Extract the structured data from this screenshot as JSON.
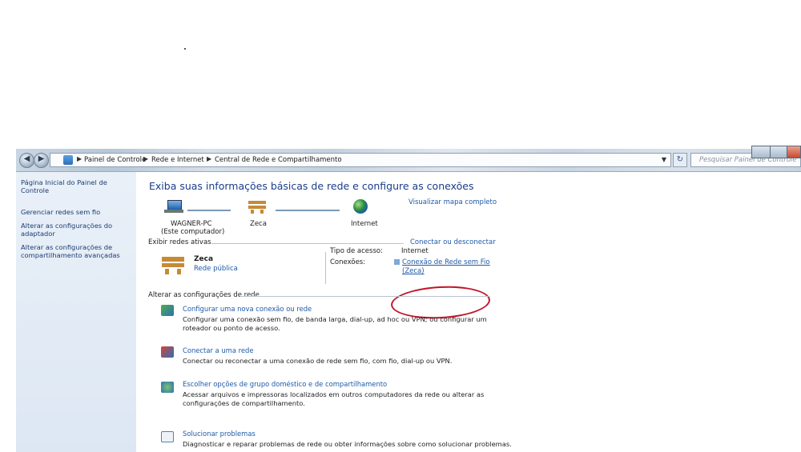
{
  "window": {
    "breadcrumbs": [
      "Painel de Controle",
      "Rede e Internet",
      "Central de Rede e Compartilhamento"
    ],
    "search_placeholder": "Pesquisar Painel de Controle"
  },
  "sidebar": {
    "items": [
      {
        "label": "Página Inicial do Painel de Controle"
      },
      {
        "label": "Gerenciar redes sem fio"
      },
      {
        "label": "Alterar as configurações do adaptador"
      },
      {
        "label": "Alterar as configurações de compartilhamento avançadas"
      }
    ]
  },
  "main": {
    "title": "Exiba suas informações básicas de rede e configure as conexões",
    "map_link": "Visualizar mapa completo",
    "map": {
      "computer": "WAGNER-PC",
      "computer_note": "(Este computador)",
      "network": "Zeca",
      "internet": "Internet"
    },
    "active_section": "Exibir redes ativas",
    "connect_link": "Conectar ou desconectar",
    "network": {
      "name": "Zeca",
      "type": "Rede pública",
      "access_label": "Tipo de acesso:",
      "access_value": "Internet",
      "connections_label": "Conexões:",
      "connection_line1": "Conexão de Rede sem Fio",
      "connection_line2": "(Zeca)"
    },
    "settings_section": "Alterar as configurações de rede",
    "tasks": [
      {
        "title": "Configurar uma nova conexão ou rede",
        "desc1": "Configurar uma conexão sem fio, de banda larga, dial-up, ad hoc ou VPN; ou configurar um",
        "desc2": "roteador ou ponto de acesso."
      },
      {
        "title": "Conectar a uma rede",
        "desc1": "Conectar ou reconectar a uma conexão de rede sem fio, com fio, dial-up ou VPN.",
        "desc2": ""
      },
      {
        "title": "Escolher opções de grupo doméstico e de compartilhamento",
        "desc1": "Acessar arquivos e impressoras localizados em outros computadores da rede ou alterar as",
        "desc2": "configurações de compartilhamento."
      },
      {
        "title": "Solucionar problemas",
        "desc1": "Diagnosticar e reparar problemas de rede ou obter informações sobre como solucionar problemas.",
        "desc2": ""
      }
    ]
  },
  "icons": {
    "computer": "computer-icon",
    "bench": "bench-network-icon",
    "globe": "internet-globe-icon"
  },
  "colors": {
    "link": "#1f5aa8",
    "title": "#1a3d8a",
    "annotation": "#c3142a"
  }
}
